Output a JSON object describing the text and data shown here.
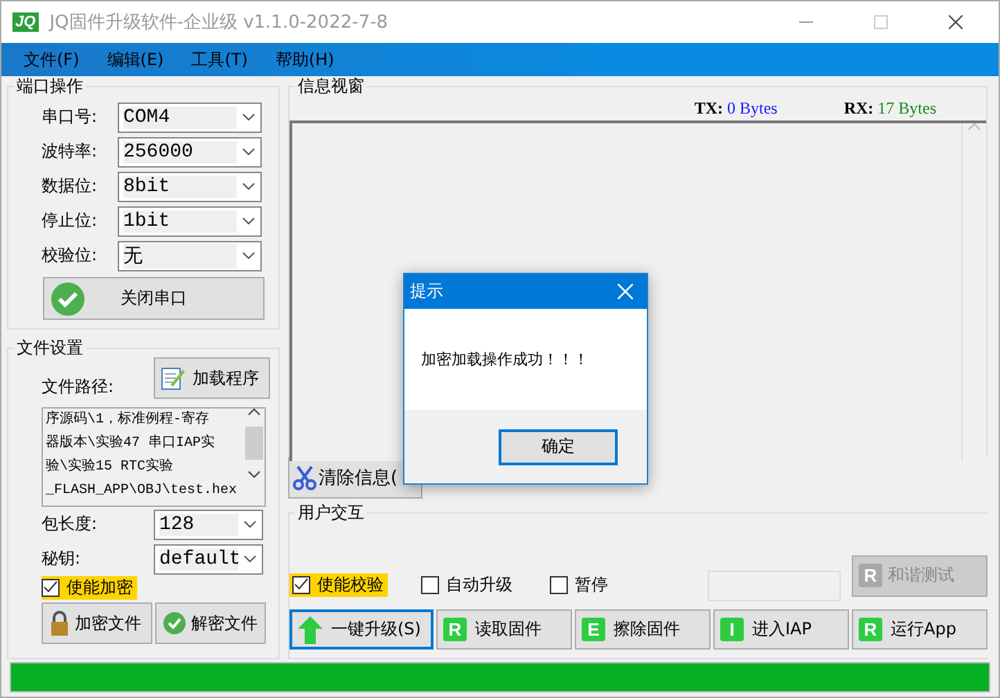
{
  "window": {
    "title": "JQ固件升级软件-企业级 v1.1.0-2022-7-8",
    "logo": "JQ"
  },
  "menu": [
    "文件(F)",
    "编辑(E)",
    "工具(T)",
    "帮助(H)"
  ],
  "port_group": {
    "title": "端口操作",
    "fields": [
      {
        "label": "串口号:",
        "value": "COM4"
      },
      {
        "label": "波特率:",
        "value": "256000"
      },
      {
        "label": "数据位:",
        "value": "8bit"
      },
      {
        "label": "停止位:",
        "value": "1bit"
      },
      {
        "label": "校验位:",
        "value": "无"
      }
    ],
    "close_button": "关闭串口"
  },
  "file_group": {
    "title": "文件设置",
    "path_label": "文件路径:",
    "load_button": "加载程序",
    "path_lines": [
      "序源码\\1，标准例程-寄存",
      "器版本\\实验47 串口IAP实",
      "验\\实验15 RTC实验",
      "_FLASH_APP\\OBJ\\test.hex"
    ],
    "fields": [
      {
        "label": "包长度:",
        "value": "128"
      },
      {
        "label": "秘钥:",
        "value": "default"
      }
    ],
    "encrypt": {
      "label": "使能加密",
      "checked": true
    },
    "buttons": [
      {
        "label": "加密文件",
        "kind": "lock"
      },
      {
        "label": "解密文件",
        "kind": "check"
      }
    ]
  },
  "info": {
    "title": "信息视窗",
    "tx_label": "TX:",
    "tx_value": "0 Bytes",
    "rx_label": "RX:",
    "rx_value": "17 Bytes",
    "clear_button": "清除信息("
  },
  "user": {
    "title": "用户交互",
    "options": [
      {
        "label": "使能校验",
        "checked": true,
        "highlight": true
      },
      {
        "label": "自动升级",
        "checked": false,
        "highlight": false
      },
      {
        "label": "暂停",
        "checked": false,
        "highlight": false
      }
    ],
    "test_button": {
      "label": "和谐测试",
      "badge": "R",
      "disabled": true
    },
    "actions": [
      {
        "label": "一键升级(S)",
        "kind": "arrow",
        "selected": true
      },
      {
        "label": "读取固件",
        "kind": "badge",
        "badge": "R",
        "selected": false
      },
      {
        "label": "擦除固件",
        "kind": "badge",
        "badge": "E",
        "selected": false
      },
      {
        "label": "进入IAP",
        "kind": "badge",
        "badge": "I",
        "selected": false
      },
      {
        "label": "运行App",
        "kind": "badge",
        "badge": "R",
        "selected": false
      }
    ]
  },
  "progress": {
    "level": 1
  },
  "dialog": {
    "title": "提示",
    "message": "加密加载操作成功！！！",
    "ok_button": "确定"
  }
}
